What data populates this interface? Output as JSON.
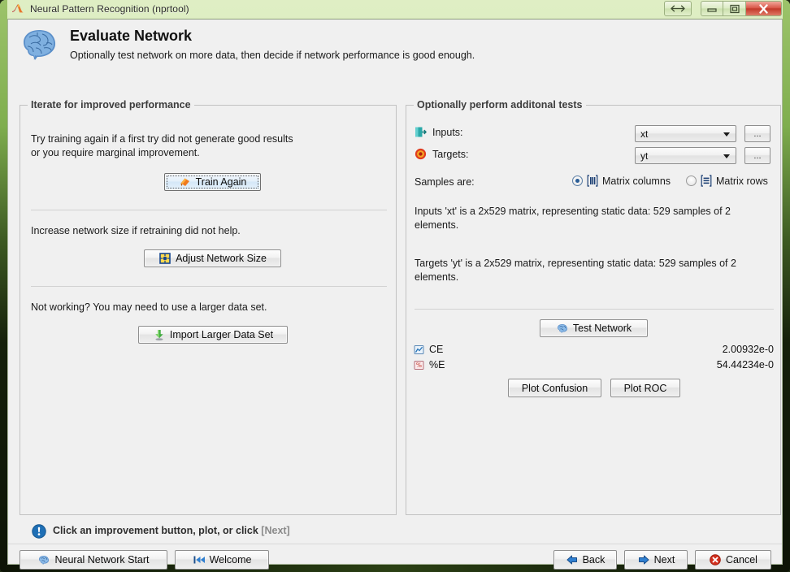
{
  "window": {
    "title": "Neural Pattern Recognition (nprtool)",
    "logo_icon": "matlab-membrane-icon",
    "controls": [
      {
        "name": "resize-button",
        "icon": "resize-arrows-icon"
      },
      {
        "name": "minimize-button",
        "icon": "minimize-icon"
      },
      {
        "name": "maximize-button",
        "icon": "maximize-icon"
      },
      {
        "name": "close-button",
        "icon": "close-x-icon"
      }
    ]
  },
  "header": {
    "icon": "brain-icon",
    "title": "Evaluate Network",
    "subtitle": "Optionally test network on more data, then decide if network performance is good enough."
  },
  "left_panel": {
    "title": "Iterate for improved performance",
    "sections": [
      {
        "text_line1": "Try training again if a first try did not generate good results",
        "text_line2": "or you require marginal improvement.",
        "button_label": "Train Again",
        "button_icon": "train-again-icon",
        "focused": true
      },
      {
        "text_line1": "Increase network size if retraining did not help.",
        "button_label": "Adjust Network Size",
        "button_icon": "adjust-network-size-icon",
        "focused": false
      },
      {
        "text_line1": "Not working? You may need to use a larger data set.",
        "button_label": "Import Larger Data Set",
        "button_icon": "import-data-icon",
        "focused": false
      }
    ]
  },
  "right_panel": {
    "title": "Optionally perform additonal tests",
    "inputs": {
      "label": "Inputs:",
      "icon": "inputs-icon",
      "value": "xt",
      "browse_label": "...",
      "browse_icon": "ellipsis-icon"
    },
    "targets": {
      "label": "Targets:",
      "icon": "targets-bullseye-icon",
      "value": "yt",
      "browse_label": "...",
      "browse_icon": "ellipsis-icon"
    },
    "samples": {
      "label": "Samples are:",
      "options": [
        {
          "label": "Matrix columns",
          "icon": "matrix-columns-icon",
          "selected": true
        },
        {
          "label": "Matrix rows",
          "icon": "matrix-rows-icon",
          "selected": false
        }
      ]
    },
    "description": {
      "inputs_text": "Inputs 'xt' is a 2x529 matrix, representing static data: 529 samples of 2 elements.",
      "targets_text": "Targets 'yt' is a 2x529 matrix, representing static data: 529 samples of 2 elements."
    },
    "test_button": {
      "label": "Test Network",
      "icon": "brain-small-icon"
    },
    "results": [
      {
        "icon": "ce-metric-icon",
        "name": "CE",
        "value": "2.00932e-0"
      },
      {
        "icon": "percent-error-icon",
        "name": "%E",
        "value": "54.44234e-0"
      }
    ],
    "plot_buttons": [
      {
        "label": "Plot Confusion",
        "name": "plot-confusion-button"
      },
      {
        "label": "Plot ROC",
        "name": "plot-roc-button"
      }
    ]
  },
  "status": {
    "icon": "info-icon",
    "text_main": "Click an improvement button, plot, or click ",
    "text_dim": "[Next]"
  },
  "footer": {
    "left_buttons": [
      {
        "label": "Neural Network Start",
        "icon": "brain-small-icon",
        "name": "neural-network-start-button"
      },
      {
        "label": "Welcome",
        "icon": "rewind-icon",
        "name": "welcome-button"
      }
    ],
    "right_buttons": [
      {
        "label": "Back",
        "icon": "arrow-left-icon",
        "name": "back-button"
      },
      {
        "label": "Next",
        "icon": "arrow-right-icon",
        "name": "next-button"
      },
      {
        "label": "Cancel",
        "icon": "cancel-icon",
        "name": "cancel-button"
      }
    ]
  },
  "colors": {
    "titlebar_green": "#cfe3ad",
    "frame_dark": "#0d1406",
    "panel_bg": "#f0f0f0",
    "accent_blue": "#2a5d96",
    "close_red": "#c23a2a"
  }
}
